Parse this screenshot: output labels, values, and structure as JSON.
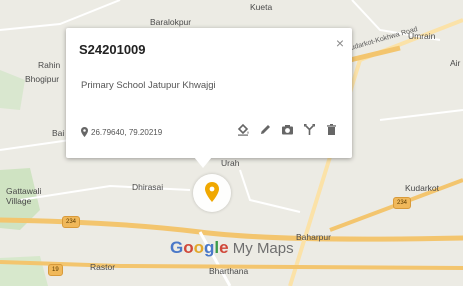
{
  "map": {
    "places": {
      "kuela": "Kueta",
      "baralokpur": "Baralokpur",
      "umrain": "Umrain",
      "rahin": "Rahin",
      "bhogipur": "Bhogipur",
      "air": "Air",
      "bai": "Bai",
      "urah": "Urah",
      "gattawali": "Gattawali",
      "village": "Village",
      "dhirasai": "Dhirasai",
      "kudarkot": "Kudarkot",
      "baharpur": "Baharpur",
      "bharthana": "Bharthana",
      "rastor": "Rastor"
    },
    "road_name": "Kudarkot-Kokhwa Road",
    "shields": {
      "s1": "234",
      "s2": "234",
      "s3": "19"
    },
    "watermark": {
      "letters": [
        "G",
        "o",
        "o",
        "g",
        "l",
        "e"
      ],
      "suffix": " My Maps"
    }
  },
  "popup": {
    "title": "S24201009",
    "description": "Primary School Jatupur Khwajgi",
    "coordinates": "26.79640, 79.20219",
    "close_symbol": "×",
    "tools": [
      "fill-icon",
      "edit-icon",
      "camera-icon",
      "directions-icon",
      "delete-icon"
    ]
  },
  "colors": {
    "marker": "#f0a800",
    "map_bg": "#ecebe4",
    "road": "#f3c56e"
  }
}
